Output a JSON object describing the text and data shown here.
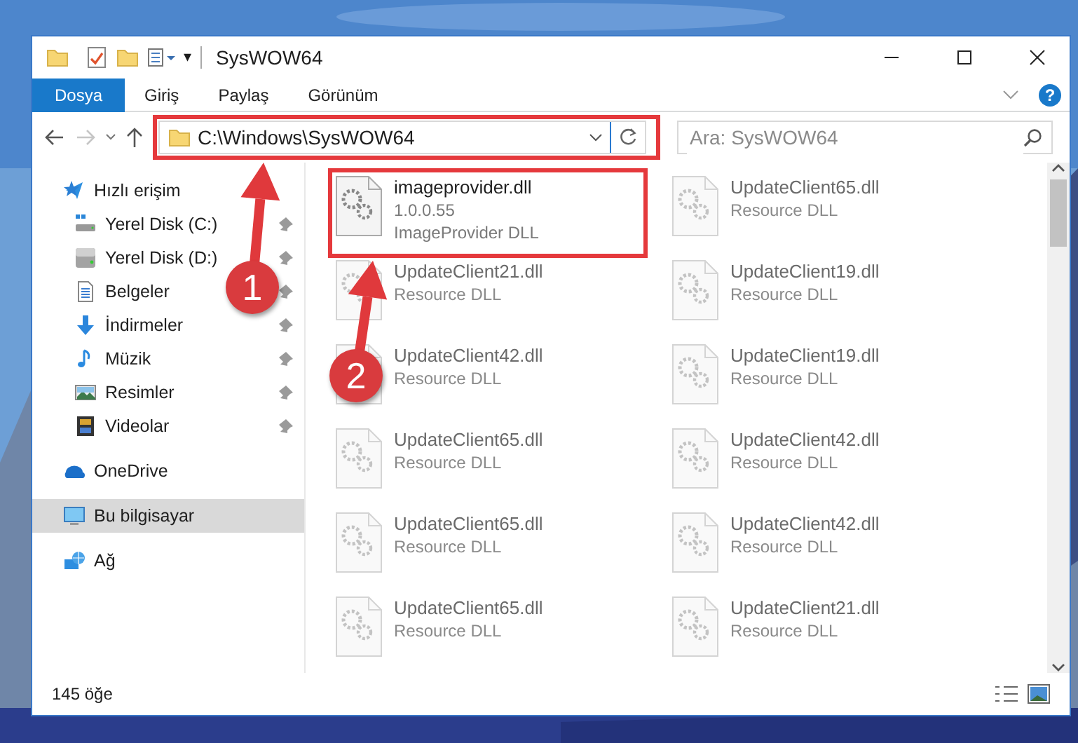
{
  "window": {
    "title": "SysWOW64",
    "quick_access_caret": "▾"
  },
  "ribbon": {
    "tabs": [
      {
        "label": "Dosya",
        "selected": true
      },
      {
        "label": "Giriş",
        "selected": false
      },
      {
        "label": "Paylaş",
        "selected": false
      },
      {
        "label": "Görünüm",
        "selected": false
      }
    ],
    "help": "?"
  },
  "navigation": {
    "back_disabled": false,
    "forward_disabled": true,
    "address": "C:\\Windows\\SysWOW64",
    "search": {
      "placeholder": "Ara: SysWOW64"
    }
  },
  "sidebar": {
    "items": [
      {
        "label": "Hızlı erişim",
        "selected": false,
        "children": [
          {
            "label": "Yerel Disk (C:)",
            "pinned": true,
            "selected": false
          },
          {
            "label": "Yerel Disk (D:)",
            "pinned": true,
            "selected": false
          },
          {
            "label": "Belgeler",
            "pinned": true,
            "selected": false
          },
          {
            "label": "İndirmeler",
            "pinned": true,
            "selected": false
          },
          {
            "label": "Müzik",
            "pinned": true,
            "selected": false
          },
          {
            "label": "Resimler",
            "pinned": true,
            "selected": false
          },
          {
            "label": "Videolar",
            "pinned": true,
            "selected": false
          }
        ]
      },
      {
        "label": "OneDrive",
        "selected": false
      },
      {
        "label": "Bu bilgisayar",
        "selected": true
      },
      {
        "label": "Ağ",
        "selected": false
      }
    ]
  },
  "files": [
    {
      "name": "imageprovider.dll",
      "lines": [
        "1.0.0.55",
        "ImageProvider DLL"
      ],
      "blurred": false
    },
    {
      "name": "UpdateClient65.dll",
      "lines": [
        "Resource DLL"
      ],
      "blurred": true
    },
    {
      "name": "UpdateClient21.dll",
      "lines": [
        "Resource DLL"
      ],
      "blurred": true
    },
    {
      "name": "UpdateClient19.dll",
      "lines": [
        "Resource DLL"
      ],
      "blurred": true
    },
    {
      "name": "UpdateClient42.dll",
      "lines": [
        "Resource DLL"
      ],
      "blurred": true
    },
    {
      "name": "UpdateClient19.dll",
      "lines": [
        "Resource DLL"
      ],
      "blurred": true
    },
    {
      "name": "UpdateClient65.dll",
      "lines": [
        "Resource DLL"
      ],
      "blurred": true
    },
    {
      "name": "UpdateClient42.dll",
      "lines": [
        "Resource DLL"
      ],
      "blurred": true
    },
    {
      "name": "UpdateClient65.dll",
      "lines": [
        "Resource DLL"
      ],
      "blurred": true
    },
    {
      "name": "UpdateClient42.dll",
      "lines": [
        "Resource DLL"
      ],
      "blurred": true
    },
    {
      "name": "UpdateClient65.dll",
      "lines": [
        "Resource DLL"
      ],
      "blurred": true
    },
    {
      "name": "UpdateClient21.dll",
      "lines": [
        "Resource DLL"
      ],
      "blurred": true
    }
  ],
  "status_bar": {
    "count": "145 öğe"
  },
  "annotations": [
    {
      "label": "1"
    },
    {
      "label": "2"
    }
  ]
}
